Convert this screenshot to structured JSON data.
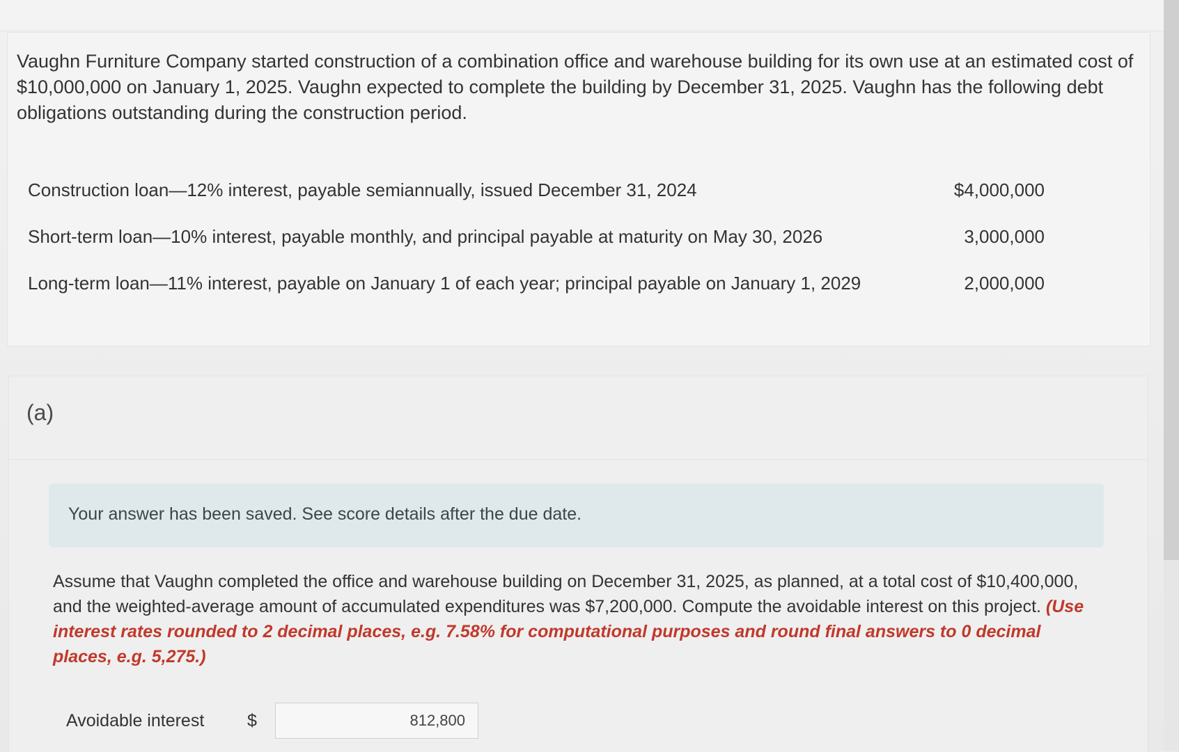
{
  "problem": {
    "intro": "Vaughn Furniture Company started construction of a combination office and warehouse building for its own use at an estimated cost of $10,000,000 on January 1, 2025. Vaughn expected to complete the building by December 31, 2025. Vaughn has the following debt obligations outstanding during the construction period.",
    "debts": [
      {
        "description": "Construction loan—12% interest, payable semiannually, issued December 31, 2024",
        "amount": "$4,000,000"
      },
      {
        "description": "Short-term loan—10% interest, payable monthly, and principal payable at maturity on May 30, 2026",
        "amount": "3,000,000"
      },
      {
        "description": "Long-term loan—11% interest, payable on January 1 of each year; principal payable on January 1, 2029",
        "amount": "2,000,000"
      }
    ]
  },
  "part": {
    "label": "(a)",
    "saved_message": "Your answer has been saved. See score details after the due date.",
    "assume_text": "Assume that Vaughn completed the office and warehouse building on December 31, 2025, as planned, at a total cost of $10,400,000, and the weighted-average amount of accumulated expenditures was $7,200,000. Compute the avoidable interest on this project.",
    "instruction": "(Use interest rates rounded to 2 decimal places, e.g. 7.58% for computational purposes and round final answers to 0 decimal places, e.g. 5,275.)",
    "answer": {
      "label": "Avoidable interest",
      "currency": "$",
      "value": "812,800"
    }
  }
}
